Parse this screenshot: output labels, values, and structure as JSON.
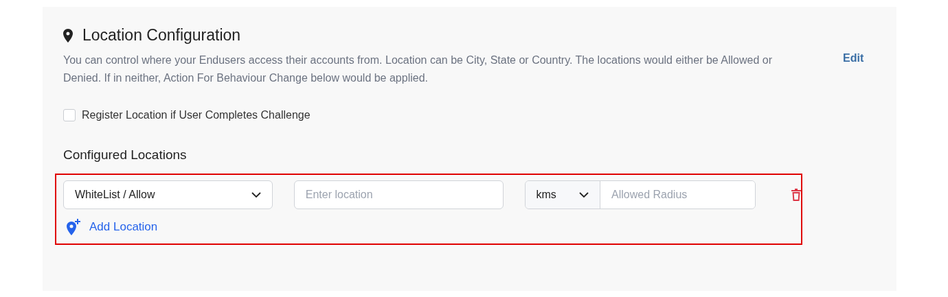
{
  "section": {
    "title": "Location Configuration",
    "description": "You can control where your Endusers access their accounts from. Location can be City, State or Country. The locations would either be Allowed or Denied. If in neither, Action For Behaviour Change below would be applied.",
    "edit": "Edit"
  },
  "register_checkbox": {
    "label": "Register Location if User Completes Challenge",
    "checked": false
  },
  "configured": {
    "title": "Configured Locations",
    "rows": [
      {
        "list_type": "WhiteList / Allow",
        "location_placeholder": "Enter location",
        "unit": "kms",
        "radius_placeholder": "Allowed Radius"
      }
    ],
    "add_button": "Add Location"
  }
}
